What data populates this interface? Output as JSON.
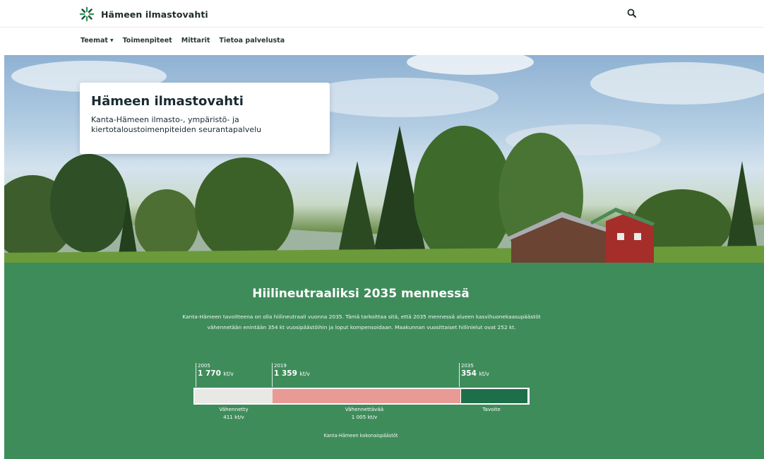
{
  "header": {
    "brand_name": "Hämeen ilmastovahti",
    "logo_icon": "burst-logo-icon",
    "search_icon": "search-icon"
  },
  "nav": {
    "items": [
      {
        "label": "Teemat",
        "has_dropdown": true
      },
      {
        "label": "Toimenpiteet"
      },
      {
        "label": "Mittarit"
      },
      {
        "label": "Tietoa palvelusta"
      }
    ]
  },
  "hero": {
    "title": "Hämeen ilmastovahti",
    "subtitle": "Kanta-Hämeen ilmasto-, ympäristö- ja kiertotaloustoimenpiteiden seurantapalvelu"
  },
  "carbon": {
    "title": "Hiilineutraaliksi 2035 mennessä",
    "description": "Kanta-Hämeen tavoitteena on olla hiilineutraali vuonna 2035. Tämä tarkoittaa sitä, että 2035 mennessä alueen kasvihuonekaasupäästöt vähennetään enintään 354 kt vuosipäästöihin ja loput kompensoidaan. Maakunnan vuosittaiset hiilinielut ovat 252 kt.",
    "milestones": [
      {
        "year": "2005",
        "value": "1 770",
        "unit": "kt/v"
      },
      {
        "year": "2019",
        "value": "1 359",
        "unit": "kt/v"
      },
      {
        "year": "2035",
        "value": "354",
        "unit": "kt/v"
      }
    ],
    "segments": [
      {
        "label": "Vähennetty",
        "value": "411 kt/v",
        "color": "#e8e8e4"
      },
      {
        "label": "Vähennettävää",
        "value": "1 005 kt/v",
        "color": "#e89a94"
      },
      {
        "label": "Tavoite",
        "value": "",
        "color": "#1f6e4a"
      }
    ],
    "footer_label": "Kanta-Hämeen kokonaispäästöt"
  },
  "colors": {
    "section_green": "#3f8c5b",
    "target_green": "#1f6e4a",
    "reduce_pink": "#e89a94"
  }
}
